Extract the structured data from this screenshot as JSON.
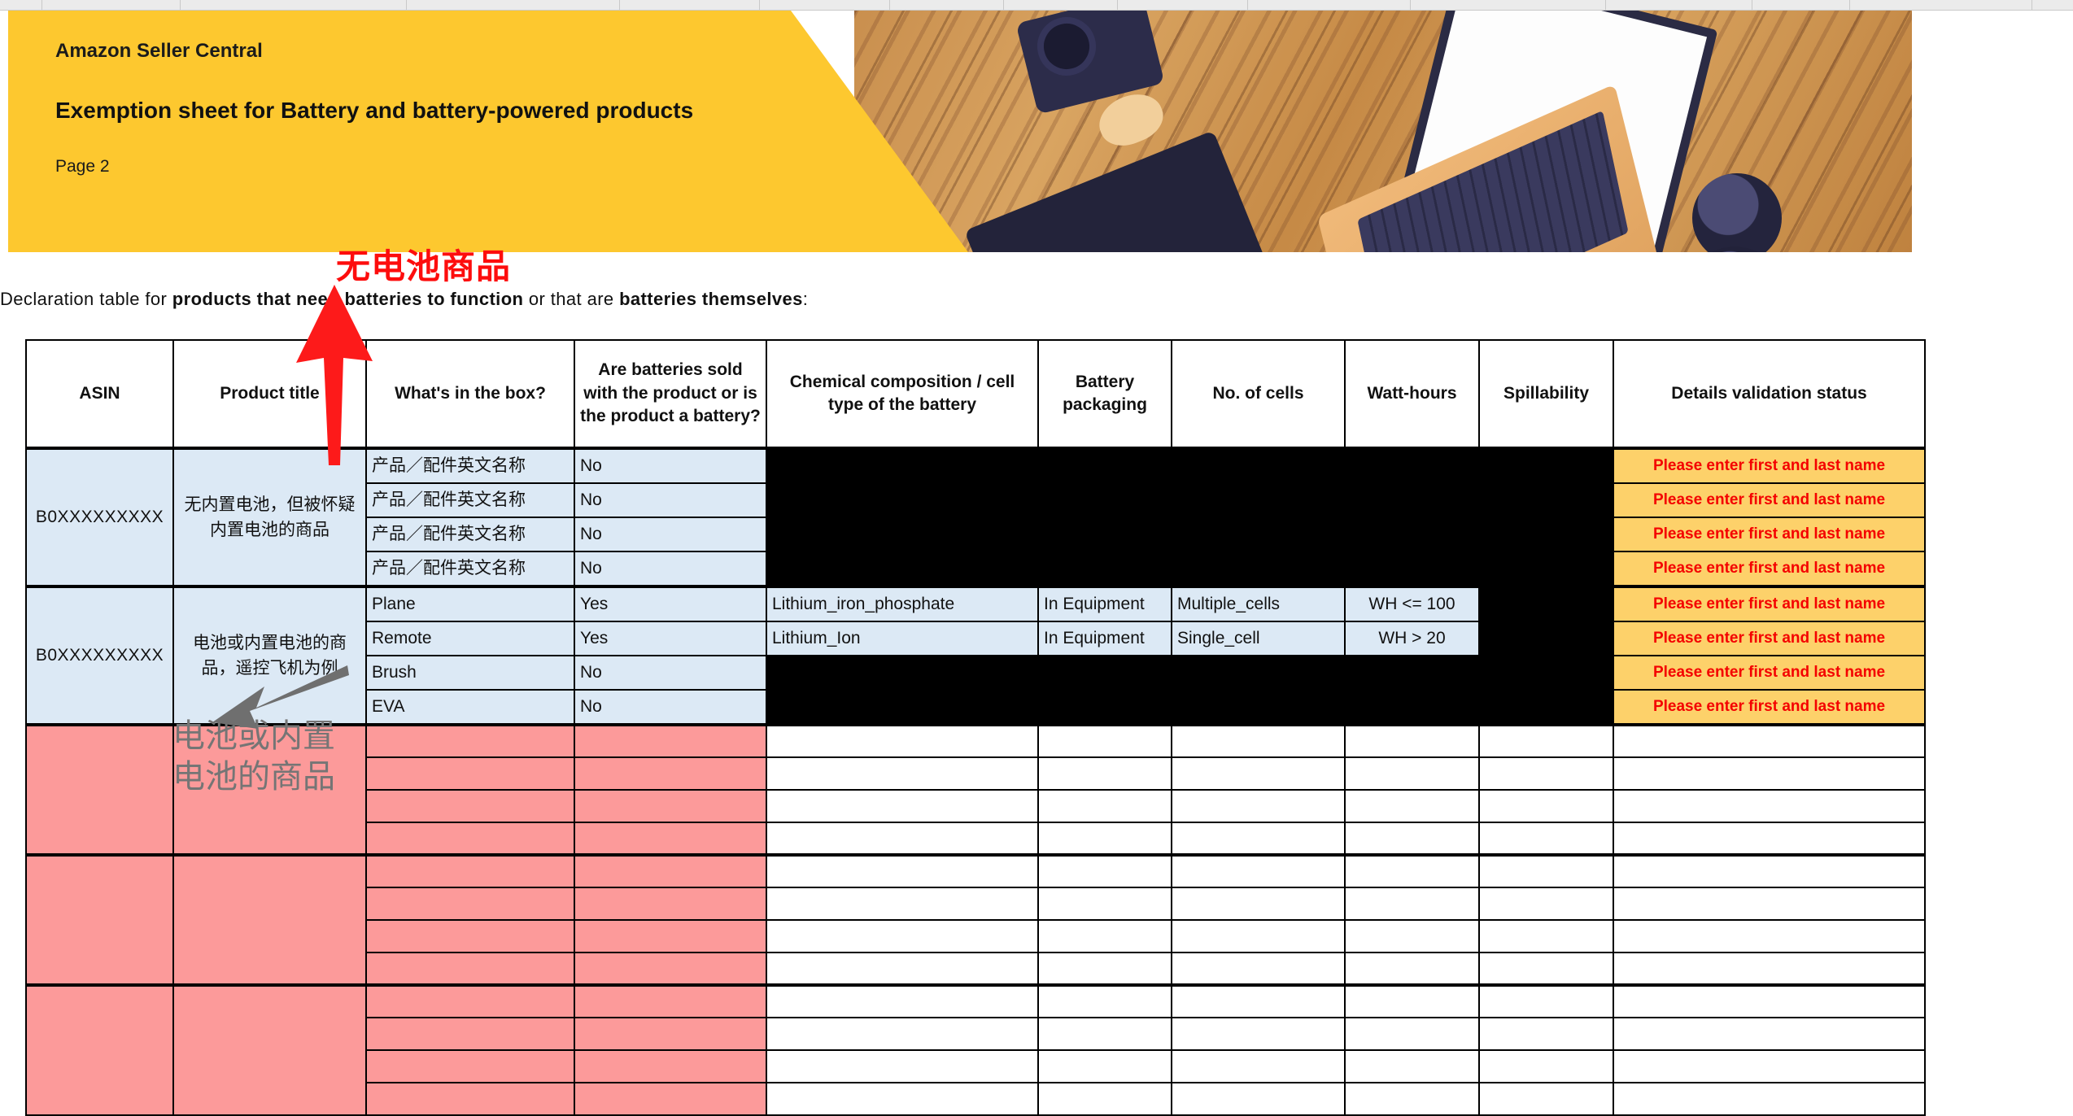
{
  "sheet": {
    "strip_columns": [
      52,
      170,
      278,
      262,
      172,
      160,
      140,
      140,
      160,
      200,
      240,
      180,
      120,
      224
    ]
  },
  "banner": {
    "app_name": "Amazon Seller Central",
    "title": "Exemption sheet for Battery and battery-powered products",
    "page_label": "Page 2",
    "bg_color": "#fdc82f",
    "photo_alt": "desk-photo-laptop-camera-tablet"
  },
  "declaration": {
    "prefix": "Declaration  table  for  ",
    "bold1": "products that need batteries to function",
    "middle": "  or   that   are  ",
    "bold2": "batteries themselves",
    "suffix": ":"
  },
  "annotations": {
    "red_label": "无电池商品",
    "red_color": "#fd0d0d",
    "gray_label_line1": "电池或内置",
    "gray_label_line2": "电池的商品",
    "gray_color": "#757575"
  },
  "table": {
    "headers": [
      "ASIN",
      "Product title",
      "What's in the box?",
      "Are batteries sold with the product or is the product a battery?",
      "Chemical composition / cell type of the battery",
      "Battery packaging",
      "No. of cells",
      "Watt-hours",
      "Spillability",
      "Details validation status"
    ],
    "status_text": "Please enter first and last name",
    "status_bg": "#fdd16a",
    "status_color": "#f40000",
    "row_groups": [
      {
        "asin": "B0XXXXXXXXX",
        "title": "无内置电池，但被怀疑内置电池的商品",
        "fill": "blue",
        "rows": [
          {
            "box": "产品／配件英文名称",
            "sold": "No",
            "chem": "",
            "pack": "",
            "cells": "",
            "watt": "",
            "spill": "",
            "status": "Please enter first and last name"
          },
          {
            "box": "产品／配件英文名称",
            "sold": "No",
            "chem": "",
            "pack": "",
            "cells": "",
            "watt": "",
            "spill": "",
            "status": "Please enter first and last name"
          },
          {
            "box": "产品／配件英文名称",
            "sold": "No",
            "chem": "",
            "pack": "",
            "cells": "",
            "watt": "",
            "spill": "",
            "status": "Please enter first and last name"
          },
          {
            "box": "产品／配件英文名称",
            "sold": "No",
            "chem": "",
            "pack": "",
            "cells": "",
            "watt": "",
            "spill": "",
            "status": "Please enter first and last name"
          }
        ]
      },
      {
        "asin": "B0XXXXXXXXX",
        "title": "电池或内置电池的商品，遥控飞机为例",
        "fill": "blue",
        "rows": [
          {
            "box": "Plane",
            "sold": "Yes",
            "chem": "Lithium_iron_phosphate",
            "pack": "In  Equipment",
            "cells": "Multiple_cells",
            "watt": "WH  <= 100",
            "spill": "",
            "status": "Please enter first and last name"
          },
          {
            "box": "Remote",
            "sold": "Yes",
            "chem": "Lithium_Ion",
            "pack": "In  Equipment",
            "cells": "Single_cell",
            "watt": "WH  > 20",
            "spill": "",
            "status": "Please enter first and last name"
          },
          {
            "box": "Brush",
            "sold": "No",
            "chem": "",
            "pack": "",
            "cells": "",
            "watt": "",
            "spill": "",
            "status": "Please enter first and last name"
          },
          {
            "box": "EVA",
            "sold": "No",
            "chem": "",
            "pack": "",
            "cells": "",
            "watt": "",
            "spill": "",
            "status": "Please enter first and last name"
          }
        ]
      },
      {
        "asin": "",
        "title": "",
        "fill": "pink",
        "rows": [
          {
            "box": "",
            "sold": "",
            "chem": "",
            "pack": "",
            "cells": "",
            "watt": "",
            "spill": "",
            "status": ""
          },
          {
            "box": "",
            "sold": "",
            "chem": "",
            "pack": "",
            "cells": "",
            "watt": "",
            "spill": "",
            "status": ""
          },
          {
            "box": "",
            "sold": "",
            "chem": "",
            "pack": "",
            "cells": "",
            "watt": "",
            "spill": "",
            "status": ""
          },
          {
            "box": "",
            "sold": "",
            "chem": "",
            "pack": "",
            "cells": "",
            "watt": "",
            "spill": "",
            "status": ""
          }
        ]
      },
      {
        "asin": "",
        "title": "",
        "fill": "pink",
        "rows": [
          {
            "box": "",
            "sold": "",
            "chem": "",
            "pack": "",
            "cells": "",
            "watt": "",
            "spill": "",
            "status": ""
          },
          {
            "box": "",
            "sold": "",
            "chem": "",
            "pack": "",
            "cells": "",
            "watt": "",
            "spill": "",
            "status": ""
          },
          {
            "box": "",
            "sold": "",
            "chem": "",
            "pack": "",
            "cells": "",
            "watt": "",
            "spill": "",
            "status": ""
          },
          {
            "box": "",
            "sold": "",
            "chem": "",
            "pack": "",
            "cells": "",
            "watt": "",
            "spill": "",
            "status": ""
          }
        ]
      },
      {
        "asin": "",
        "title": "",
        "fill": "pink",
        "rows": [
          {
            "box": "",
            "sold": "",
            "chem": "",
            "pack": "",
            "cells": "",
            "watt": "",
            "spill": "",
            "status": ""
          },
          {
            "box": "",
            "sold": "",
            "chem": "",
            "pack": "",
            "cells": "",
            "watt": "",
            "spill": "",
            "status": ""
          },
          {
            "box": "",
            "sold": "",
            "chem": "",
            "pack": "",
            "cells": "",
            "watt": "",
            "spill": "",
            "status": ""
          },
          {
            "box": "",
            "sold": "",
            "chem": "",
            "pack": "",
            "cells": "",
            "watt": "",
            "spill": "",
            "status": ""
          }
        ]
      }
    ]
  }
}
